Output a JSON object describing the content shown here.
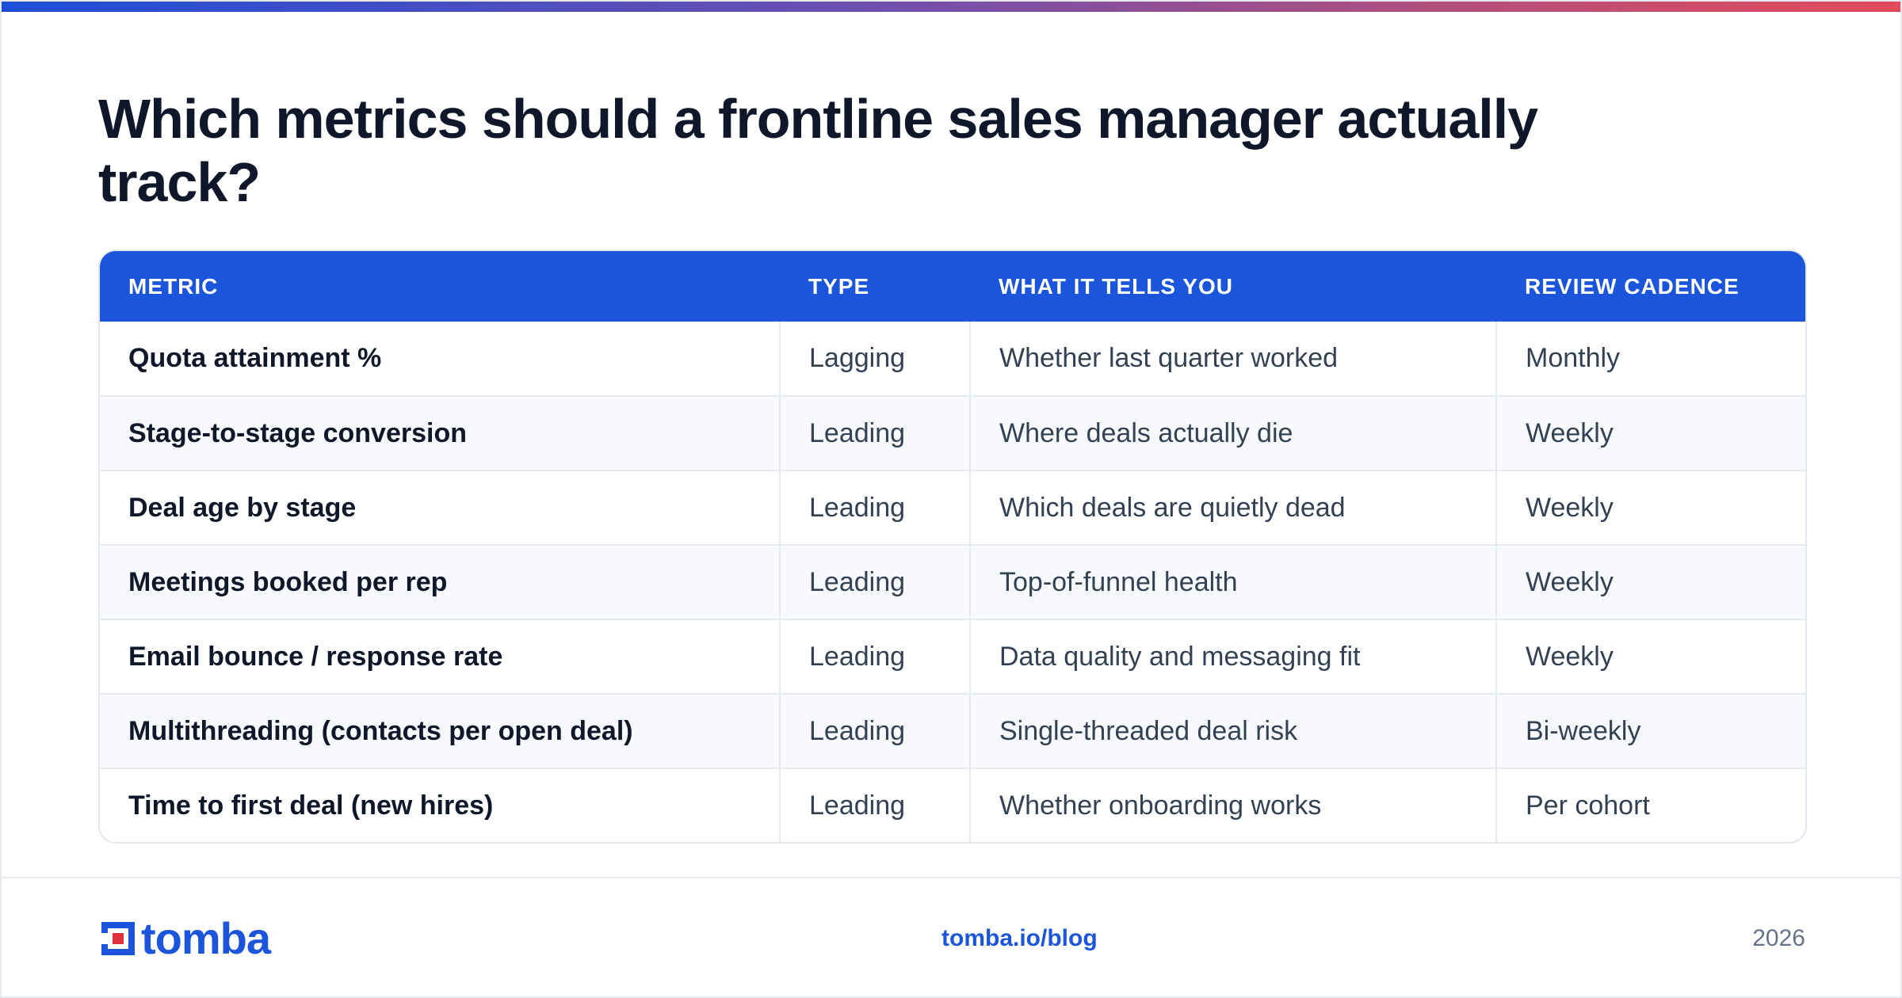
{
  "title": "Which metrics should a frontline sales manager actually track?",
  "table": {
    "headers": [
      "METRIC",
      "TYPE",
      "WHAT IT TELLS YOU",
      "REVIEW CADENCE"
    ],
    "rows": [
      [
        "Quota attainment %",
        "Lagging",
        "Whether last quarter worked",
        "Monthly"
      ],
      [
        "Stage-to-stage conversion",
        "Leading",
        "Where deals actually die",
        "Weekly"
      ],
      [
        "Deal age by stage",
        "Leading",
        "Which deals are quietly dead",
        "Weekly"
      ],
      [
        "Meetings booked per rep",
        "Leading",
        "Top-of-funnel health",
        "Weekly"
      ],
      [
        "Email bounce / response rate",
        "Leading",
        "Data quality and messaging fit",
        "Weekly"
      ],
      [
        "Multithreading (contacts per open deal)",
        "Leading",
        "Single-threaded deal risk",
        "Bi-weekly"
      ],
      [
        "Time to first deal (new hires)",
        "Leading",
        "Whether onboarding works",
        "Per cohort"
      ]
    ]
  },
  "footer": {
    "logo_text": "tomba",
    "link": "tomba.io/blog",
    "year": "2026"
  },
  "colors": {
    "accent": "#1b55dc",
    "logo_red": "#e0323c",
    "title": "#0f172a",
    "body_text": "#334155"
  },
  "icons": {
    "logo": "tomba-logo-mark-icon"
  }
}
